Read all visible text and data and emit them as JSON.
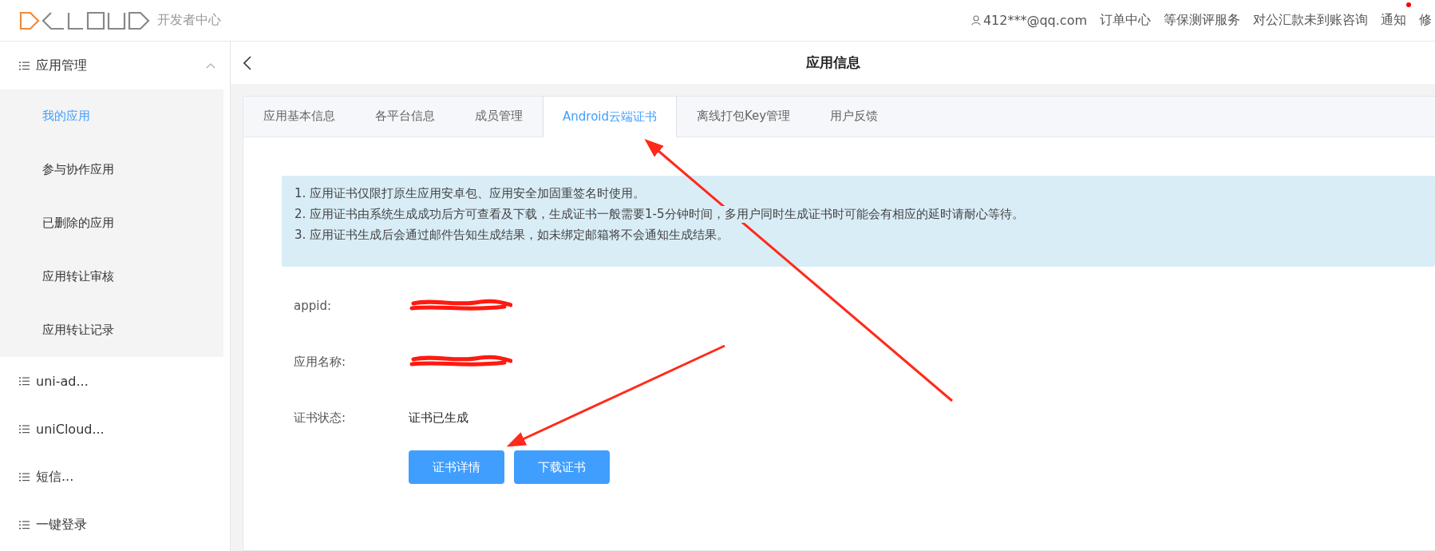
{
  "header": {
    "logo_suffix": "开发者中心",
    "user": "412***@qq.com",
    "nav": [
      {
        "label": "订单中心",
        "badge": false
      },
      {
        "label": "等保测评服务",
        "badge": false
      },
      {
        "label": "对公汇款未到账咨询",
        "badge": false
      },
      {
        "label": "通知",
        "badge": true
      },
      {
        "label": "修",
        "badge": false
      }
    ]
  },
  "sidebar": {
    "items": [
      {
        "label": "应用管理",
        "expanded": true,
        "children": [
          {
            "label": "我的应用",
            "selected": true
          },
          {
            "label": "参与协作应用",
            "selected": false
          },
          {
            "label": "已删除的应用",
            "selected": false
          },
          {
            "label": "应用转让审核",
            "selected": false
          },
          {
            "label": "应用转让记录",
            "selected": false
          }
        ]
      },
      {
        "label": "uni-ad...",
        "expanded": false
      },
      {
        "label": "uniCloud...",
        "expanded": false
      },
      {
        "label": "短信...",
        "expanded": false
      },
      {
        "label": "一键登录",
        "expanded": false
      }
    ]
  },
  "page": {
    "title": "应用信息"
  },
  "tabs": [
    {
      "label": "应用基本信息",
      "selected": false
    },
    {
      "label": "各平台信息",
      "selected": false
    },
    {
      "label": "成员管理",
      "selected": false
    },
    {
      "label": "Android云端证书",
      "selected": true
    },
    {
      "label": "离线打包Key管理",
      "selected": false
    },
    {
      "label": "用户反馈",
      "selected": false
    }
  ],
  "notice": [
    "1. 应用证书仅限打原生应用安卓包、应用安全加固重签名时使用。",
    "2. 应用证书由系统生成成功后方可查看及下载，生成证书一般需要1-5分钟时间，多用户同时生成证书时可能会有相应的延时请耐心等待。",
    "3. 应用证书生成后会通过邮件告知生成结果，如未绑定邮箱将不会通知生成结果。"
  ],
  "fields": [
    {
      "label": "appid:",
      "kind": "redacted"
    },
    {
      "label": "应用名称:",
      "kind": "redacted"
    },
    {
      "label": "证书状态:",
      "kind": "text",
      "value": "证书已生成"
    }
  ],
  "buttons": [
    "证书详情",
    "下载证书"
  ]
}
